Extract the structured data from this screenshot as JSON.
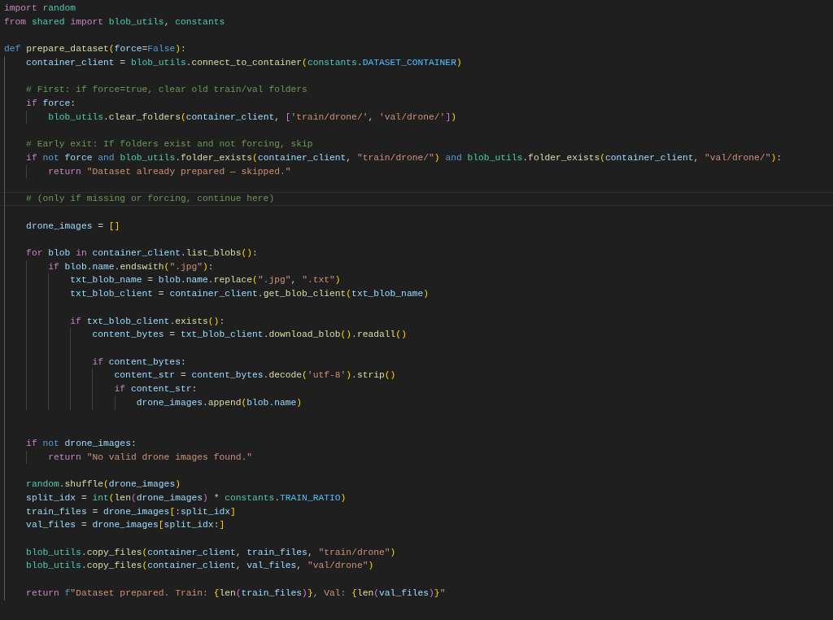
{
  "editor": {
    "lines": [
      {
        "kind": "code",
        "current": false,
        "tokens": [
          {
            "kind": "kw",
            "text": "import "
          },
          {
            "kind": "mod",
            "text": "random"
          }
        ]
      },
      {
        "kind": "code",
        "current": false,
        "tokens": [
          {
            "kind": "kw",
            "text": "from "
          },
          {
            "kind": "mod",
            "text": "shared "
          },
          {
            "kind": "kw",
            "text": "import "
          },
          {
            "kind": "mod",
            "text": "blob_utils"
          },
          {
            "kind": "punc",
            "text": ", "
          },
          {
            "kind": "mod",
            "text": "constants"
          }
        ]
      },
      {
        "kind": "blank",
        "current": false
      },
      {
        "kind": "code",
        "current": false,
        "tokens": [
          {
            "kind": "st",
            "text": "def "
          },
          {
            "kind": "fn",
            "text": "prepare_dataset"
          },
          {
            "kind": "b1",
            "text": "("
          },
          {
            "kind": "var",
            "text": "force"
          },
          {
            "kind": "punc",
            "text": "="
          },
          {
            "kind": "st",
            "text": "False"
          },
          {
            "kind": "b1",
            "text": ")"
          },
          {
            "kind": "punc",
            "text": ":"
          }
        ]
      },
      {
        "kind": "code",
        "current": false,
        "tokens": [
          {
            "kind": "var",
            "text": "    container_client"
          },
          {
            "kind": "punc",
            "text": " = "
          },
          {
            "kind": "mod",
            "text": "blob_utils"
          },
          {
            "kind": "punc",
            "text": "."
          },
          {
            "kind": "fn",
            "text": "connect_to_container"
          },
          {
            "kind": "b1",
            "text": "("
          },
          {
            "kind": "mod",
            "text": "constants"
          },
          {
            "kind": "punc",
            "text": "."
          },
          {
            "kind": "const",
            "text": "DATASET_CONTAINER"
          },
          {
            "kind": "b1",
            "text": ")"
          }
        ]
      },
      {
        "kind": "blank",
        "current": false
      },
      {
        "kind": "code",
        "current": false,
        "tokens": [
          {
            "kind": "cmt",
            "text": "    # First: if force=true, clear old train/val folders"
          }
        ]
      },
      {
        "kind": "code",
        "current": false,
        "tokens": [
          {
            "kind": "kw",
            "text": "    if "
          },
          {
            "kind": "var",
            "text": "force"
          },
          {
            "kind": "punc",
            "text": ":"
          }
        ]
      },
      {
        "kind": "code",
        "current": false,
        "tokens": [
          {
            "kind": "mod",
            "text": "        blob_utils"
          },
          {
            "kind": "punc",
            "text": "."
          },
          {
            "kind": "fn",
            "text": "clear_folders"
          },
          {
            "kind": "b1",
            "text": "("
          },
          {
            "kind": "var",
            "text": "container_client"
          },
          {
            "kind": "punc",
            "text": ", "
          },
          {
            "kind": "b2",
            "text": "["
          },
          {
            "kind": "str",
            "text": "'train/drone/'"
          },
          {
            "kind": "punc",
            "text": ", "
          },
          {
            "kind": "str",
            "text": "'val/drone/'"
          },
          {
            "kind": "b2",
            "text": "]"
          },
          {
            "kind": "b1",
            "text": ")"
          }
        ]
      },
      {
        "kind": "blank",
        "current": false
      },
      {
        "kind": "code",
        "current": false,
        "tokens": [
          {
            "kind": "cmt",
            "text": "    # Early exit: If folders exist and not forcing, skip"
          }
        ]
      },
      {
        "kind": "code",
        "current": false,
        "tokens": [
          {
            "kind": "kw",
            "text": "    if "
          },
          {
            "kind": "st",
            "text": "not "
          },
          {
            "kind": "var",
            "text": "force "
          },
          {
            "kind": "st",
            "text": "and "
          },
          {
            "kind": "mod",
            "text": "blob_utils"
          },
          {
            "kind": "punc",
            "text": "."
          },
          {
            "kind": "fn",
            "text": "folder_exists"
          },
          {
            "kind": "b1",
            "text": "("
          },
          {
            "kind": "var",
            "text": "container_client"
          },
          {
            "kind": "punc",
            "text": ", "
          },
          {
            "kind": "str",
            "text": "\"train/drone/\""
          },
          {
            "kind": "b1",
            "text": ") "
          },
          {
            "kind": "st",
            "text": "and "
          },
          {
            "kind": "mod",
            "text": "blob_utils"
          },
          {
            "kind": "punc",
            "text": "."
          },
          {
            "kind": "fn",
            "text": "folder_exists"
          },
          {
            "kind": "b1",
            "text": "("
          },
          {
            "kind": "var",
            "text": "container_client"
          },
          {
            "kind": "punc",
            "text": ", "
          },
          {
            "kind": "str",
            "text": "\"val/drone/\""
          },
          {
            "kind": "b1",
            "text": ")"
          },
          {
            "kind": "punc",
            "text": ":"
          }
        ]
      },
      {
        "kind": "code",
        "current": false,
        "tokens": [
          {
            "kind": "kw",
            "text": "        return "
          },
          {
            "kind": "str",
            "text": "\"Dataset already prepared — skipped.\""
          }
        ]
      },
      {
        "kind": "blank",
        "current": false
      },
      {
        "kind": "code",
        "current": true,
        "tokens": [
          {
            "kind": "cmt",
            "text": "    # (only if missing or forcing, continue here)"
          }
        ]
      },
      {
        "kind": "blank",
        "current": false
      },
      {
        "kind": "code",
        "current": false,
        "tokens": [
          {
            "kind": "var",
            "text": "    drone_images"
          },
          {
            "kind": "punc",
            "text": " = "
          },
          {
            "kind": "b1",
            "text": "[]"
          }
        ]
      },
      {
        "kind": "blank",
        "current": false
      },
      {
        "kind": "code",
        "current": false,
        "tokens": [
          {
            "kind": "kw",
            "text": "    for "
          },
          {
            "kind": "var",
            "text": "blob "
          },
          {
            "kind": "kw",
            "text": "in "
          },
          {
            "kind": "var",
            "text": "container_client"
          },
          {
            "kind": "punc",
            "text": "."
          },
          {
            "kind": "fn",
            "text": "list_blobs"
          },
          {
            "kind": "b1",
            "text": "()"
          },
          {
            "kind": "punc",
            "text": ":"
          }
        ]
      },
      {
        "kind": "code",
        "current": false,
        "tokens": [
          {
            "kind": "kw",
            "text": "        if "
          },
          {
            "kind": "var",
            "text": "blob"
          },
          {
            "kind": "punc",
            "text": "."
          },
          {
            "kind": "var",
            "text": "name"
          },
          {
            "kind": "punc",
            "text": "."
          },
          {
            "kind": "fn",
            "text": "endswith"
          },
          {
            "kind": "b1",
            "text": "("
          },
          {
            "kind": "str",
            "text": "\".jpg\""
          },
          {
            "kind": "b1",
            "text": ")"
          },
          {
            "kind": "punc",
            "text": ":"
          }
        ]
      },
      {
        "kind": "code",
        "current": false,
        "tokens": [
          {
            "kind": "var",
            "text": "            txt_blob_name"
          },
          {
            "kind": "punc",
            "text": " = "
          },
          {
            "kind": "var",
            "text": "blob"
          },
          {
            "kind": "punc",
            "text": "."
          },
          {
            "kind": "var",
            "text": "name"
          },
          {
            "kind": "punc",
            "text": "."
          },
          {
            "kind": "fn",
            "text": "replace"
          },
          {
            "kind": "b1",
            "text": "("
          },
          {
            "kind": "str",
            "text": "\".jpg\""
          },
          {
            "kind": "punc",
            "text": ", "
          },
          {
            "kind": "str",
            "text": "\".txt\""
          },
          {
            "kind": "b1",
            "text": ")"
          }
        ]
      },
      {
        "kind": "code",
        "current": false,
        "tokens": [
          {
            "kind": "var",
            "text": "            txt_blob_client"
          },
          {
            "kind": "punc",
            "text": " = "
          },
          {
            "kind": "var",
            "text": "container_client"
          },
          {
            "kind": "punc",
            "text": "."
          },
          {
            "kind": "fn",
            "text": "get_blob_client"
          },
          {
            "kind": "b1",
            "text": "("
          },
          {
            "kind": "var",
            "text": "txt_blob_name"
          },
          {
            "kind": "b1",
            "text": ")"
          }
        ]
      },
      {
        "kind": "blank",
        "current": false
      },
      {
        "kind": "code",
        "current": false,
        "tokens": [
          {
            "kind": "kw",
            "text": "            if "
          },
          {
            "kind": "var",
            "text": "txt_blob_client"
          },
          {
            "kind": "punc",
            "text": "."
          },
          {
            "kind": "fn",
            "text": "exists"
          },
          {
            "kind": "b1",
            "text": "()"
          },
          {
            "kind": "punc",
            "text": ":"
          }
        ]
      },
      {
        "kind": "code",
        "current": false,
        "tokens": [
          {
            "kind": "var",
            "text": "                content_bytes"
          },
          {
            "kind": "punc",
            "text": " = "
          },
          {
            "kind": "var",
            "text": "txt_blob_client"
          },
          {
            "kind": "punc",
            "text": "."
          },
          {
            "kind": "fn",
            "text": "download_blob"
          },
          {
            "kind": "b1",
            "text": "()"
          },
          {
            "kind": "punc",
            "text": "."
          },
          {
            "kind": "fn",
            "text": "readall"
          },
          {
            "kind": "b1",
            "text": "()"
          }
        ]
      },
      {
        "kind": "blank",
        "current": false
      },
      {
        "kind": "code",
        "current": false,
        "tokens": [
          {
            "kind": "kw",
            "text": "                if "
          },
          {
            "kind": "var",
            "text": "content_bytes"
          },
          {
            "kind": "punc",
            "text": ":"
          }
        ]
      },
      {
        "kind": "code",
        "current": false,
        "tokens": [
          {
            "kind": "var",
            "text": "                    content_str"
          },
          {
            "kind": "punc",
            "text": " = "
          },
          {
            "kind": "var",
            "text": "content_bytes"
          },
          {
            "kind": "punc",
            "text": "."
          },
          {
            "kind": "fn",
            "text": "decode"
          },
          {
            "kind": "b1",
            "text": "("
          },
          {
            "kind": "str",
            "text": "'utf-8'"
          },
          {
            "kind": "b1",
            "text": ")"
          },
          {
            "kind": "punc",
            "text": "."
          },
          {
            "kind": "fn",
            "text": "strip"
          },
          {
            "kind": "b1",
            "text": "()"
          }
        ]
      },
      {
        "kind": "code",
        "current": false,
        "tokens": [
          {
            "kind": "kw",
            "text": "                    if "
          },
          {
            "kind": "var",
            "text": "content_str"
          },
          {
            "kind": "punc",
            "text": ":"
          }
        ]
      },
      {
        "kind": "code",
        "current": false,
        "tokens": [
          {
            "kind": "var",
            "text": "                        drone_images"
          },
          {
            "kind": "punc",
            "text": "."
          },
          {
            "kind": "fn",
            "text": "append"
          },
          {
            "kind": "b1",
            "text": "("
          },
          {
            "kind": "var",
            "text": "blob"
          },
          {
            "kind": "punc",
            "text": "."
          },
          {
            "kind": "var",
            "text": "name"
          },
          {
            "kind": "b1",
            "text": ")"
          }
        ]
      },
      {
        "kind": "blank",
        "current": false
      },
      {
        "kind": "blank",
        "current": false
      },
      {
        "kind": "code",
        "current": false,
        "tokens": [
          {
            "kind": "kw",
            "text": "    if "
          },
          {
            "kind": "st",
            "text": "not "
          },
          {
            "kind": "var",
            "text": "drone_images"
          },
          {
            "kind": "punc",
            "text": ":"
          }
        ]
      },
      {
        "kind": "code",
        "current": false,
        "tokens": [
          {
            "kind": "kw",
            "text": "        return "
          },
          {
            "kind": "str",
            "text": "\"No valid drone images found.\""
          }
        ]
      },
      {
        "kind": "blank",
        "current": false
      },
      {
        "kind": "code",
        "current": false,
        "tokens": [
          {
            "kind": "mod",
            "text": "    random"
          },
          {
            "kind": "punc",
            "text": "."
          },
          {
            "kind": "fn",
            "text": "shuffle"
          },
          {
            "kind": "b1",
            "text": "("
          },
          {
            "kind": "var",
            "text": "drone_images"
          },
          {
            "kind": "b1",
            "text": ")"
          }
        ]
      },
      {
        "kind": "code",
        "current": false,
        "tokens": [
          {
            "kind": "var",
            "text": "    split_idx"
          },
          {
            "kind": "punc",
            "text": " = "
          },
          {
            "kind": "mod",
            "text": "int"
          },
          {
            "kind": "b1",
            "text": "("
          },
          {
            "kind": "fn",
            "text": "len"
          },
          {
            "kind": "b2",
            "text": "("
          },
          {
            "kind": "var",
            "text": "drone_images"
          },
          {
            "kind": "b2",
            "text": ")"
          },
          {
            "kind": "punc",
            "text": " * "
          },
          {
            "kind": "mod",
            "text": "constants"
          },
          {
            "kind": "punc",
            "text": "."
          },
          {
            "kind": "const",
            "text": "TRAIN_RATIO"
          },
          {
            "kind": "b1",
            "text": ")"
          }
        ]
      },
      {
        "kind": "code",
        "current": false,
        "tokens": [
          {
            "kind": "var",
            "text": "    train_files"
          },
          {
            "kind": "punc",
            "text": " = "
          },
          {
            "kind": "var",
            "text": "drone_images"
          },
          {
            "kind": "b1",
            "text": "["
          },
          {
            "kind": "punc",
            "text": ":"
          },
          {
            "kind": "var",
            "text": "split_idx"
          },
          {
            "kind": "b1",
            "text": "]"
          }
        ]
      },
      {
        "kind": "code",
        "current": false,
        "tokens": [
          {
            "kind": "var",
            "text": "    val_files"
          },
          {
            "kind": "punc",
            "text": " = "
          },
          {
            "kind": "var",
            "text": "drone_images"
          },
          {
            "kind": "b1",
            "text": "["
          },
          {
            "kind": "var",
            "text": "split_idx"
          },
          {
            "kind": "punc",
            "text": ":"
          },
          {
            "kind": "b1",
            "text": "]"
          }
        ]
      },
      {
        "kind": "blank",
        "current": false
      },
      {
        "kind": "code",
        "current": false,
        "tokens": [
          {
            "kind": "mod",
            "text": "    blob_utils"
          },
          {
            "kind": "punc",
            "text": "."
          },
          {
            "kind": "fn",
            "text": "copy_files"
          },
          {
            "kind": "b1",
            "text": "("
          },
          {
            "kind": "var",
            "text": "container_client"
          },
          {
            "kind": "punc",
            "text": ", "
          },
          {
            "kind": "var",
            "text": "train_files"
          },
          {
            "kind": "punc",
            "text": ", "
          },
          {
            "kind": "str",
            "text": "\"train/drone\""
          },
          {
            "kind": "b1",
            "text": ")"
          }
        ]
      },
      {
        "kind": "code",
        "current": false,
        "tokens": [
          {
            "kind": "mod",
            "text": "    blob_utils"
          },
          {
            "kind": "punc",
            "text": "."
          },
          {
            "kind": "fn",
            "text": "copy_files"
          },
          {
            "kind": "b1",
            "text": "("
          },
          {
            "kind": "var",
            "text": "container_client"
          },
          {
            "kind": "punc",
            "text": ", "
          },
          {
            "kind": "var",
            "text": "val_files"
          },
          {
            "kind": "punc",
            "text": ", "
          },
          {
            "kind": "str",
            "text": "\"val/drone\""
          },
          {
            "kind": "b1",
            "text": ")"
          }
        ]
      },
      {
        "kind": "blank",
        "current": false
      },
      {
        "kind": "code",
        "current": false,
        "tokens": [
          {
            "kind": "kw",
            "text": "    return "
          },
          {
            "kind": "st",
            "text": "f"
          },
          {
            "kind": "str",
            "text": "\"Dataset prepared. Train: "
          },
          {
            "kind": "b1",
            "text": "{"
          },
          {
            "kind": "fn",
            "text": "len"
          },
          {
            "kind": "b2",
            "text": "("
          },
          {
            "kind": "var",
            "text": "train_files"
          },
          {
            "kind": "b2",
            "text": ")"
          },
          {
            "kind": "b1",
            "text": "}"
          },
          {
            "kind": "str",
            "text": ", Val: "
          },
          {
            "kind": "b1",
            "text": "{"
          },
          {
            "kind": "fn",
            "text": "len"
          },
          {
            "kind": "b2",
            "text": "("
          },
          {
            "kind": "var",
            "text": "val_files"
          },
          {
            "kind": "b2",
            "text": ")"
          },
          {
            "kind": "b1",
            "text": "}"
          },
          {
            "kind": "str",
            "text": "\""
          }
        ]
      }
    ]
  }
}
